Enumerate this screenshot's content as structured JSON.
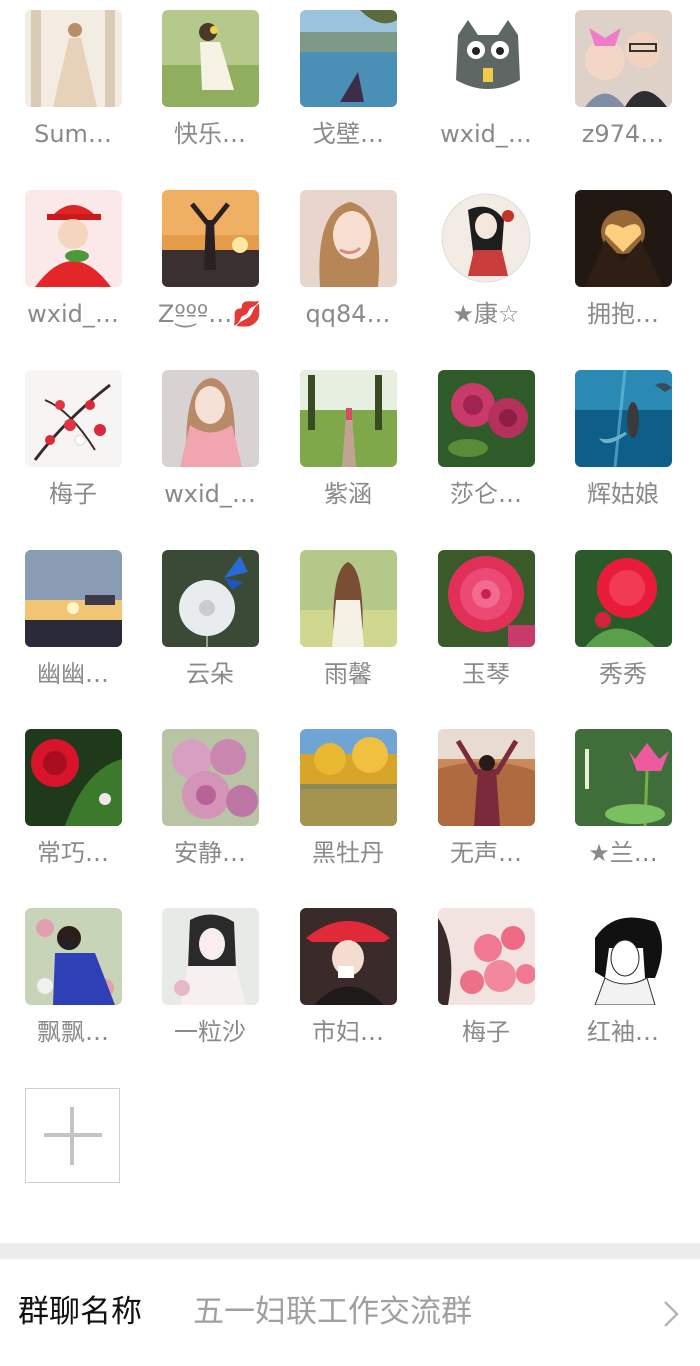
{
  "members": [
    {
      "name": "Sum…",
      "icon": "bride-portrait-avatar"
    },
    {
      "name": "快乐…",
      "icon": "girl-sitting-avatar"
    },
    {
      "name": "戈壁…",
      "icon": "lake-mountain-avatar"
    },
    {
      "name": "wxid_…",
      "icon": "cartoon-cat-avatar"
    },
    {
      "name": "z974…",
      "icon": "mother-baby-avatar"
    },
    {
      "name": "wxid_…",
      "icon": "child-red-hat-avatar"
    },
    {
      "name": "Zº͜ºº…💋",
      "icon": "sunset-silhouette-avatar"
    },
    {
      "name": "qq84…",
      "icon": "woman-portrait-avatar"
    },
    {
      "name": "★康☆",
      "icon": "ink-painting-woman-avatar"
    },
    {
      "name": "拥抱…",
      "icon": "heart-hands-avatar"
    },
    {
      "name": "梅子",
      "icon": "plum-blossom-avatar"
    },
    {
      "name": "wxid_…",
      "icon": "woman-pink-scarf-avatar"
    },
    {
      "name": "紫涵",
      "icon": "park-path-avatar"
    },
    {
      "name": "莎仑…",
      "icon": "rose-flowers-avatar"
    },
    {
      "name": "辉姑娘",
      "icon": "mermaid-ocean-avatar"
    },
    {
      "name": "幽幽…",
      "icon": "sky-sunset-avatar"
    },
    {
      "name": "云朵",
      "icon": "dandelion-butterfly-avatar"
    },
    {
      "name": "雨馨",
      "icon": "girl-meadow-avatar"
    },
    {
      "name": "玉琴",
      "icon": "pink-dahlia-avatar"
    },
    {
      "name": "秀秀",
      "icon": "red-flower-avatar"
    },
    {
      "name": "常巧…",
      "icon": "red-rose-avatar"
    },
    {
      "name": "安静…",
      "icon": "chrysanthemum-avatar"
    },
    {
      "name": "黑牡丹",
      "icon": "autumn-trees-lake-avatar"
    },
    {
      "name": "无声…",
      "icon": "woman-desert-avatar"
    },
    {
      "name": "★兰…",
      "icon": "lotus-avatar"
    },
    {
      "name": "飘飘…",
      "icon": "woman-flowers-avatar"
    },
    {
      "name": "一粒沙",
      "icon": "anime-girl-avatar"
    },
    {
      "name": "市妇…",
      "icon": "woman-red-hat-avatar"
    },
    {
      "name": "梅子",
      "icon": "pink-lily-avatar"
    },
    {
      "name": "红袖…",
      "icon": "sketch-woman-avatar"
    }
  ],
  "add_button": {
    "icon": "plus-icon"
  },
  "group_name": {
    "label": "群聊名称",
    "value": "五一妇联工作交流群",
    "icon": "chevron-right-icon"
  }
}
